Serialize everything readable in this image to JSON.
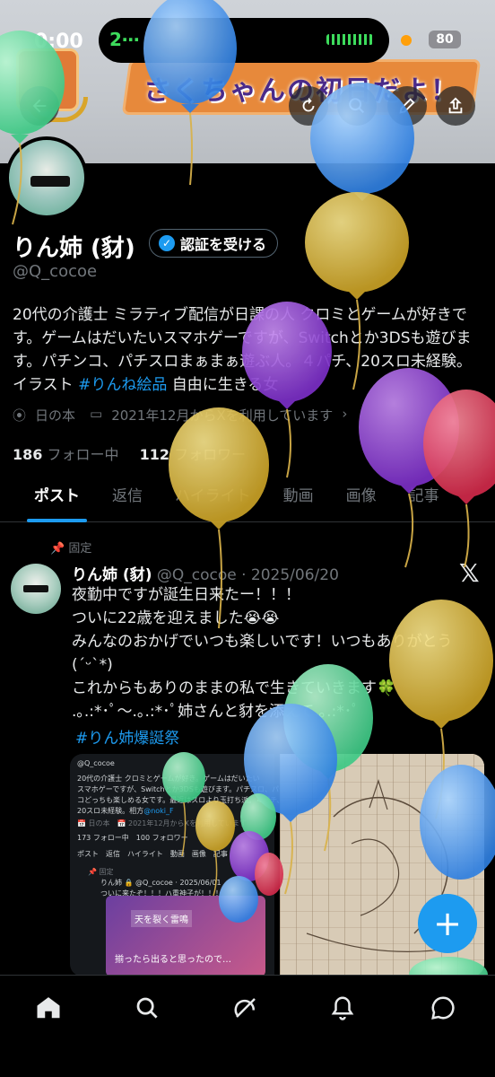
{
  "status_bar": {
    "time": "0:00",
    "call_label": "2⋯",
    "battery": "80"
  },
  "header": {
    "banner_text": "さくちゃんの初日だよ！",
    "back_icon": "arrow-left-icon",
    "refresh_icon": "refresh-icon",
    "search_icon": "search-icon",
    "edit_icon": "pen-icon",
    "share_icon": "share-icon"
  },
  "profile": {
    "display_name": "りん姉 (豺)",
    "verify_label": "認証を受ける",
    "handle": "@Q_cocoe",
    "bio_text": "20代の介護士 ミラティブ配信が日課の人 クロミとゲームが好きです。ゲームはだいたいスマホゲーですが、Switchとか3DSも遊びます。パチンコ、パチスロまぁまぁ遊ぶ人。４パチ、20スロ未経験。イラスト ",
    "bio_hashtag": "#りんね絵品",
    "bio_suffix": " 自由に生きる女",
    "location": "日の本",
    "joined": "2021年12月からXを利用しています",
    "following_count": "186",
    "following_label": "フォロー中",
    "followers_count": "112",
    "followers_label": "フォロワー"
  },
  "tabs": [
    "ポスト",
    "返信",
    "ハイライト",
    "動画",
    "画像",
    "記事"
  ],
  "pinned_tweet": {
    "pinned_label": "固定",
    "name": "りん姉 (豺)",
    "handle_date": "@Q_cocoe · 2025/06/20",
    "line1": "夜勤中ですが誕生日来たー！！！",
    "line2": "ついに22歳を迎えました😭😭",
    "line3": "みんなのおかげでいつも楽しいです！いつもありがとう",
    "line4": "(´ᵕ`*)",
    "line5": "これからもありのままの私で生きていきます🍀",
    "line6": ".｡.:*･ﾟ〜.｡.:*･ﾟ姉さんと豺を添えて.｡.:*･ﾟ",
    "hashtag": "#りん姉爆誕祭",
    "embedded": {
      "handle": "@Q_cocoe",
      "bio1": "20代の介護士 クロミとゲームが好き。ゲームはだいたい",
      "bio2": "スマホゲーですが、Switchとか3DSも遊びます。パチスロ、パチン",
      "bio3": "コどっちも楽しめる女です。最近はスロより玉打ち派。４パチ、",
      "bio4": "20スロ未経験。相方",
      "bio4_tag": "@noki_F",
      "joined": "📅 日の本　📅 2021年12月からXを利用しています",
      "follows": "173 フォロー中　100 フォロワー",
      "tabs": "ポスト　返信　ハイライト　動画　画像　記事",
      "pinned": "📌 固定",
      "tweet": "りん姉 🔒 @Q_cocoe · 2025/06/01",
      "tweet2": "ついに来たぞ！！！ハ重神子が！！！",
      "card_title": "天を裂く雷鳴",
      "card_text": "揃ったら出ると思ったので…"
    }
  },
  "fab_label": "+",
  "bottom_nav": [
    {
      "icon": "home-icon"
    },
    {
      "icon": "search-icon"
    },
    {
      "icon": "grok-icon"
    },
    {
      "icon": "bell-icon"
    },
    {
      "icon": "message-icon"
    }
  ],
  "colors": {
    "accent": "#1d9bf0",
    "background": "#000000",
    "muted": "#71767b"
  }
}
